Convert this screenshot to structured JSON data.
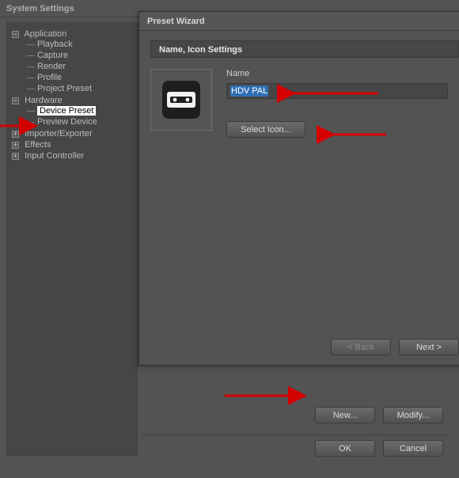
{
  "window": {
    "title": "System Settings"
  },
  "tree": {
    "application": {
      "label": "Application",
      "toggle": "−",
      "children": {
        "playback": "Playback",
        "capture": "Capture",
        "render": "Render",
        "profile": "Profile",
        "project_preset": "Project Preset"
      }
    },
    "hardware": {
      "label": "Hardware",
      "toggle": "−",
      "children": {
        "device_preset": "Device Preset",
        "preview_device": "Preview Device"
      }
    },
    "importer_exporter": {
      "label": "Importer/Exporter",
      "toggle": "+"
    },
    "effects": {
      "label": "Effects",
      "toggle": "+"
    },
    "input_controller": {
      "label": "Input Controller",
      "toggle": "+"
    }
  },
  "dialog": {
    "title": "Preset Wizard",
    "section": "Name, Icon Settings",
    "name_label": "Name",
    "name_value": "HDV PAL",
    "select_icon": "Select Icon...",
    "back": "< Back",
    "next": "Next >"
  },
  "buttons": {
    "new": "New...",
    "modify": "Modify...",
    "ok": "OK",
    "cancel": "Cancel"
  },
  "icons": {
    "cassette": "cassette-icon"
  }
}
